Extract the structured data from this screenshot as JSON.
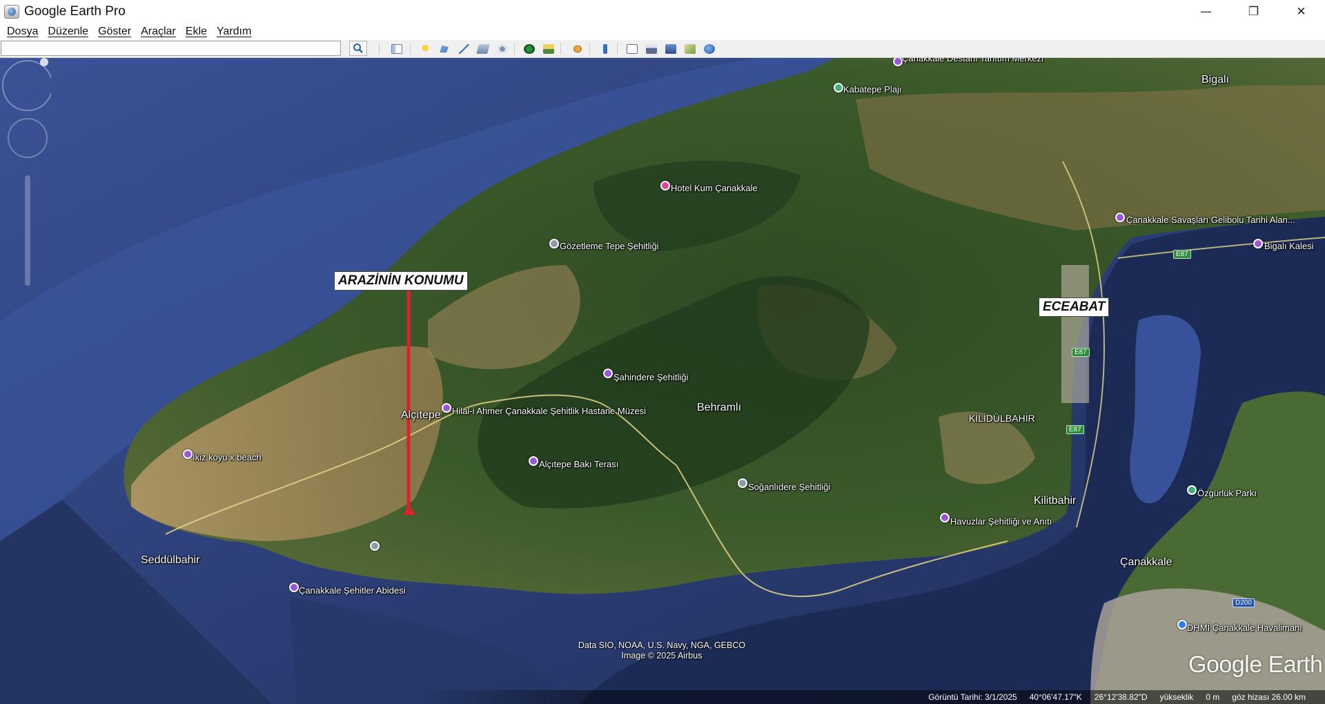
{
  "window": {
    "title": "Google Earth Pro",
    "minimize": "—",
    "restore": "❐",
    "close": "✕"
  },
  "menu": [
    "Dosya",
    "Düzenle",
    "Göster",
    "Araçlar",
    "Ekle",
    "Yardım"
  ],
  "search": {
    "value": "",
    "placeholder": ""
  },
  "toolbar_icons": [
    "sidebar-toggle-icon",
    "placemark-icon",
    "polygon-icon",
    "path-icon",
    "image-overlay-icon",
    "record-tour-icon",
    "historical-imagery-icon",
    "sunlight-icon",
    "planets-icon",
    "ruler-icon",
    "email-icon",
    "print-icon",
    "save-image-icon",
    "view-in-maps-icon",
    "earth-icon"
  ],
  "map": {
    "callouts": {
      "land": "ARAZİNİN KONUMU",
      "eceabat": "ECEABAT"
    },
    "places": {
      "destani": "Çanakkale Destanı Tanıtım Merkezi",
      "kabatepe": "Kabatepe Plajı",
      "bigali": "Bigalı",
      "hotel": "Hotel Kum Çanakkale",
      "savaslari": "Çanakkale Savaşları Gelibolu Tarihi Alan...",
      "bigali_kalesi": "Bigalı Kalesi",
      "gozetleme": "Gözetleme Tepe Şehitliği",
      "sahindere": "Şahindere Şehitliği",
      "alcitepe": "Alçıtepe",
      "hilal": "Hilal-i Ahmer Çanakkale Şehitlik Hastane Müzesi",
      "behramli": "Behramlı",
      "kilidulbahir_caps": "KİLİDÜLBAHİR",
      "ikiz": "İkiz koyu x beach",
      "alcitepe_teras": "Alçıtepe Bakı Terası",
      "soganli": "Soğanlıdere Şehitliği",
      "kilitbahir": "Kilitbahir",
      "ozgurluk": "Özgürlük Parkı",
      "havuzlar": "Havuzlar Şehitliği ve Anıtı",
      "seddulbahir": "Seddülbahir",
      "canakkale": "Çanakkale",
      "abidesi": "Çanakkale Şehitler Abidesi",
      "dhmi": "DHMİ Çanakkale Havalimanı"
    },
    "roads": {
      "e87": "E87",
      "d200": "D200"
    },
    "credits": {
      "line1": "Data SIO, NOAA, U.S. Navy, NGA, GEBCO",
      "line2": "Image © 2025 Airbus"
    },
    "logo": "Google Earth"
  },
  "status": {
    "date": "Görüntü Tarihi: 3/1/2025",
    "lat": "40°06'47.17\"K",
    "lon": "26°12'38.82\"D",
    "elev_label": "yükseklik",
    "elev": "0 m",
    "eye": "göz hizası  26.00 km"
  },
  "colors": {
    "accent_red": "#e0202a",
    "water": "#2c3f72",
    "land": "#3b5a2a"
  }
}
